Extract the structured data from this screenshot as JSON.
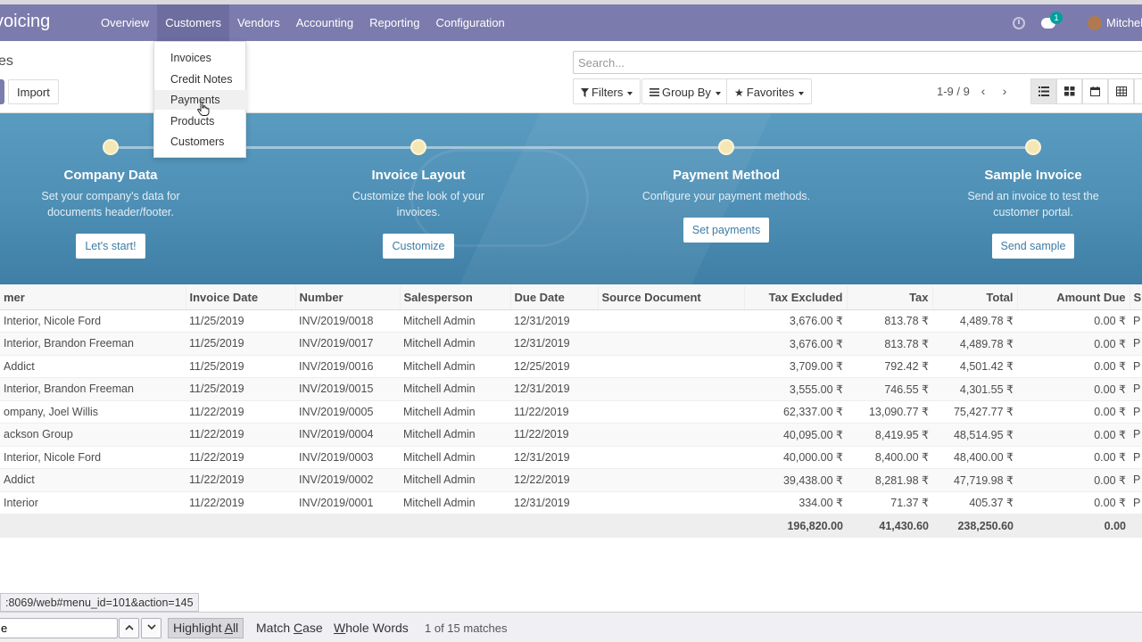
{
  "navbar": {
    "app_name": "voicing",
    "menu": [
      "Overview",
      "Customers",
      "Vendors",
      "Accounting",
      "Reporting",
      "Configuration"
    ],
    "chat_count": "1",
    "user_name": "Mitchel"
  },
  "customers_menu": {
    "items": [
      "Invoices",
      "Credit Notes",
      "Payments",
      "Products",
      "Customers"
    ],
    "hovered": "Payments"
  },
  "control_panel": {
    "breadcrumb": "es",
    "import_label": "Import",
    "search_placeholder": "Search...",
    "filters_label": "Filters",
    "group_by_label": "Group By",
    "favorites_label": "Favorites",
    "pager_value": "1-9 / 9"
  },
  "onboarding": {
    "steps": [
      {
        "title": "Company Data",
        "desc": "Set your company's data for documents header/footer.",
        "button": "Let's start!"
      },
      {
        "title": "Invoice Layout",
        "desc": "Customize the look of your invoices.",
        "button": "Customize"
      },
      {
        "title": "Payment Method",
        "desc": "Configure your payment methods.",
        "button": "Set payments"
      },
      {
        "title": "Sample Invoice",
        "desc": "Send an invoice to test the customer portal.",
        "button": "Send sample"
      }
    ]
  },
  "table": {
    "columns": [
      "mer",
      "Invoice Date",
      "Number",
      "Salesperson",
      "Due Date",
      "Source Document",
      "Tax Excluded",
      "Tax",
      "Total",
      "Amount Due",
      "S"
    ],
    "rows": [
      [
        "Interior, Nicole Ford",
        "11/25/2019",
        "INV/2019/0018",
        "Mitchell Admin",
        "12/31/2019",
        "",
        "3,676.00 ₹",
        "813.78 ₹",
        "4,489.78 ₹",
        "0.00 ₹",
        "P"
      ],
      [
        "Interior, Brandon Freeman",
        "11/25/2019",
        "INV/2019/0017",
        "Mitchell Admin",
        "12/31/2019",
        "",
        "3,676.00 ₹",
        "813.78 ₹",
        "4,489.78 ₹",
        "0.00 ₹",
        "P"
      ],
      [
        "Addict",
        "11/25/2019",
        "INV/2019/0016",
        "Mitchell Admin",
        "12/25/2019",
        "",
        "3,709.00 ₹",
        "792.42 ₹",
        "4,501.42 ₹",
        "0.00 ₹",
        "P"
      ],
      [
        "Interior, Brandon Freeman",
        "11/25/2019",
        "INV/2019/0015",
        "Mitchell Admin",
        "12/31/2019",
        "",
        "3,555.00 ₹",
        "746.55 ₹",
        "4,301.55 ₹",
        "0.00 ₹",
        "P"
      ],
      [
        "ompany, Joel Willis",
        "11/22/2019",
        "INV/2019/0005",
        "Mitchell Admin",
        "11/22/2019",
        "",
        "62,337.00 ₹",
        "13,090.77 ₹",
        "75,427.77 ₹",
        "0.00 ₹",
        "P"
      ],
      [
        "ackson Group",
        "11/22/2019",
        "INV/2019/0004",
        "Mitchell Admin",
        "11/22/2019",
        "",
        "40,095.00 ₹",
        "8,419.95 ₹",
        "48,514.95 ₹",
        "0.00 ₹",
        "P"
      ],
      [
        "Interior, Nicole Ford",
        "11/22/2019",
        "INV/2019/0003",
        "Mitchell Admin",
        "12/31/2019",
        "",
        "40,000.00 ₹",
        "8,400.00 ₹",
        "48,400.00 ₹",
        "0.00 ₹",
        "P"
      ],
      [
        "Addict",
        "11/22/2019",
        "INV/2019/0002",
        "Mitchell Admin",
        "12/22/2019",
        "",
        "39,438.00 ₹",
        "8,281.98 ₹",
        "47,719.98 ₹",
        "0.00 ₹",
        "P"
      ],
      [
        "Interior",
        "11/22/2019",
        "INV/2019/0001",
        "Mitchell Admin",
        "12/31/2019",
        "",
        "334.00 ₹",
        "71.37 ₹",
        "405.37 ₹",
        "0.00 ₹",
        "P"
      ]
    ],
    "totals": {
      "tax_excluded": "196,820.00",
      "tax": "41,430.60",
      "total": "238,250.60",
      "amount_due": "0.00"
    }
  },
  "status_url": ":8069/web#menu_id=101&action=145",
  "findbar": {
    "query": "e",
    "highlight_all": "Highlight All",
    "match_case": "Match Case",
    "whole_words": "Whole Words",
    "status": "1 of 15 matches"
  }
}
